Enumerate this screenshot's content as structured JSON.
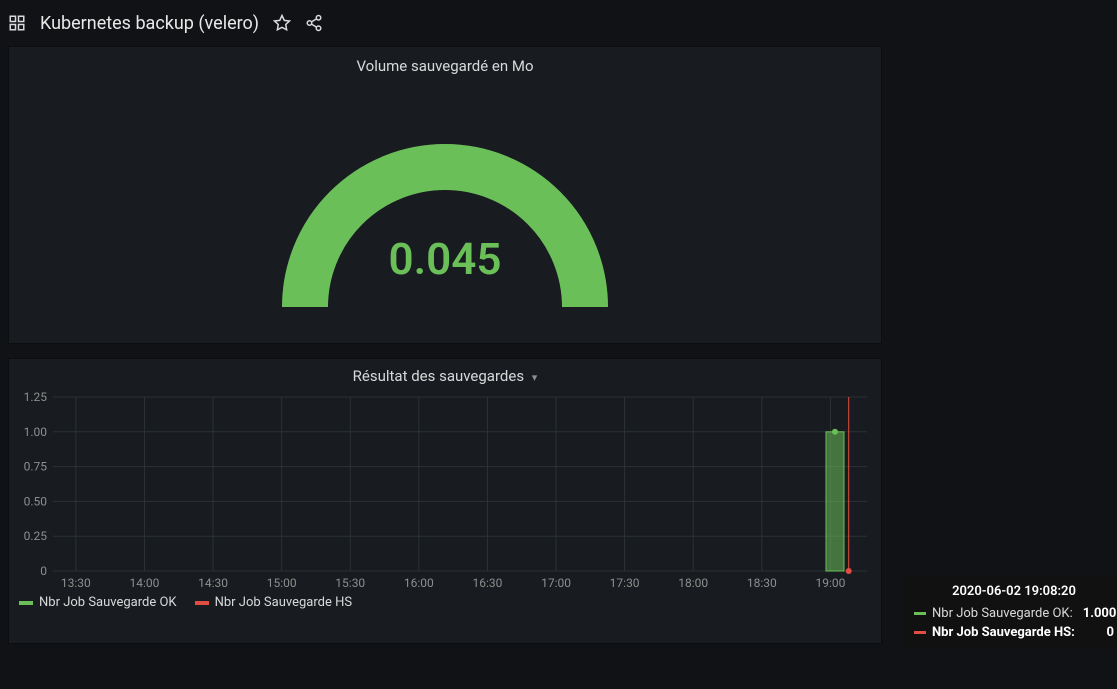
{
  "header": {
    "title": "Kubernetes backup (velero)"
  },
  "gauge": {
    "title": "Volume sauvegardé en Mo",
    "value": "0.045"
  },
  "results": {
    "title": "Résultat des sauvegardes",
    "legend": {
      "ok": "Nbr Job Sauvegarde OK",
      "hs": "Nbr Job Sauvegarde HS"
    }
  },
  "tooltip": {
    "time": "2020-06-02 19:08:20",
    "ok_label": "Nbr Job Sauvegarde OK:",
    "ok_value": "1.000",
    "hs_label": "Nbr Job Sauvegarde HS:",
    "hs_value": "0"
  },
  "chart_data": {
    "type": "bar",
    "title": "Résultat des sauvegardes",
    "xlabel": "",
    "ylabel": "",
    "ylim": [
      0,
      1.25
    ],
    "y_ticks": [
      0,
      0.25,
      0.5,
      0.75,
      1.0,
      1.25
    ],
    "x_ticks": [
      "13:30",
      "14:00",
      "14:30",
      "15:00",
      "15:30",
      "16:00",
      "16:30",
      "17:00",
      "17:30",
      "18:00",
      "18:30",
      "19:00"
    ],
    "x_range_minutes": [
      800,
      1156
    ],
    "series": [
      {
        "name": "Nbr Job Sauvegarde OK",
        "color": "#6bbf59",
        "bars": [
          {
            "x_min": 1142,
            "value": 1.0
          }
        ]
      },
      {
        "name": "Nbr Job Sauvegarde HS",
        "color": "#e24d42",
        "bars": [
          {
            "x_min": 1148,
            "value": 0.0
          }
        ]
      }
    ],
    "hover_x_min": 1148
  },
  "colors": {
    "green": "#6bbf59",
    "red": "#e24d42",
    "track": "#2c3235"
  }
}
